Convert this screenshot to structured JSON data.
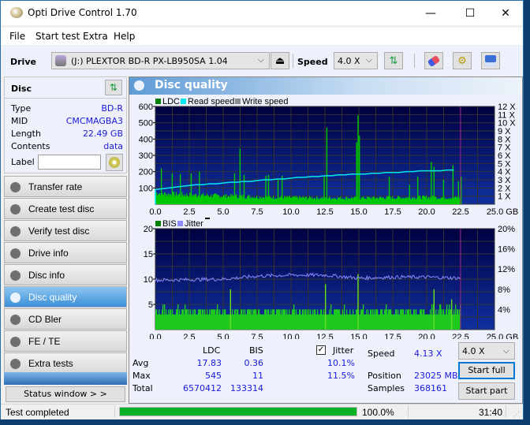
{
  "window": {
    "title": "Opti Drive Control 1.70",
    "controls": {
      "minimize": "—",
      "maximize": "☐",
      "close": "✕"
    }
  },
  "menu": [
    "File",
    "Start test",
    "Extra",
    "Help"
  ],
  "toolbar": {
    "drive_label": "Drive",
    "drive_value": "(J:)   PLEXTOR BD-R  PX-LB950SA 1.04",
    "speed_label": "Speed",
    "speed_value": "4.0 X",
    "icons": [
      "eject-icon",
      "refresh-icon",
      "erase-icon",
      "settings-icon",
      "save-icon"
    ]
  },
  "disc": {
    "header": "Disc",
    "rows": [
      {
        "key": "Type",
        "value": "BD-R"
      },
      {
        "key": "MID",
        "value": "CMCMAGBA3"
      },
      {
        "key": "Length",
        "value": "22.49 GB"
      },
      {
        "key": "Contents",
        "value": "data"
      }
    ],
    "label_key": "Label",
    "label_value": ""
  },
  "nav": [
    {
      "label": "Transfer rate",
      "active": false
    },
    {
      "label": "Create test disc",
      "active": false
    },
    {
      "label": "Verify test disc",
      "active": false
    },
    {
      "label": "Drive info",
      "active": false
    },
    {
      "label": "Disc info",
      "active": false
    },
    {
      "label": "Disc quality",
      "active": true
    },
    {
      "label": "CD Bler",
      "active": false
    },
    {
      "label": "FE / TE",
      "active": false
    },
    {
      "label": "Extra tests",
      "active": false
    }
  ],
  "status_window_button": "Status window > >",
  "panel_title": "Disc quality",
  "colors": {
    "ldc": "#00c800",
    "read_speed": "#00e8f0",
    "write_speed": "#8c8c8c",
    "bis": "#1ec81e",
    "jitter": "#8a8aff",
    "plot_bg": "#00005a",
    "progress": "#06b025",
    "value_blue": "#1a1adc"
  },
  "chart_data": [
    {
      "type": "bar",
      "title": "LDC / Read speed",
      "legend": [
        "LDC",
        "Read speed",
        "Write speed"
      ],
      "legend_position": "top-left",
      "xlabel": "GB",
      "x_ticks": [
        "0.0",
        "2.5",
        "5.0",
        "7.5",
        "10.0",
        "12.5",
        "15.0",
        "17.5",
        "20.0",
        "22.5",
        "25.0 GB"
      ],
      "xlim": [
        0,
        25
      ],
      "ylim": [
        0,
        600
      ],
      "y_ticks": [
        "100",
        "200",
        "300",
        "400",
        "500",
        "600"
      ],
      "y2_ticks": [
        "1 X",
        "2 X",
        "3 X",
        "4 X",
        "5 X",
        "6 X",
        "7 X",
        "8 X",
        "9 X",
        "10 X",
        "11 X",
        "12 X"
      ],
      "y2lim": [
        0,
        12
      ],
      "grid": true,
      "end_marker_gb": 22.49,
      "ldc_baseline": [
        [
          0,
          70
        ],
        [
          1,
          60
        ],
        [
          2,
          58
        ],
        [
          3,
          55
        ],
        [
          5,
          50
        ],
        [
          7.5,
          45
        ],
        [
          10,
          40
        ],
        [
          12.5,
          38
        ],
        [
          15,
          38
        ],
        [
          17.5,
          40
        ],
        [
          20,
          42
        ],
        [
          22.49,
          40
        ]
      ],
      "ldc_spikes": [
        [
          0.4,
          220
        ],
        [
          1.2,
          190
        ],
        [
          1.8,
          185
        ],
        [
          2.6,
          190
        ],
        [
          3.2,
          200
        ],
        [
          5.8,
          190
        ],
        [
          6.2,
          340
        ],
        [
          6.5,
          180
        ],
        [
          8.1,
          175
        ],
        [
          8.3,
          180
        ],
        [
          9.0,
          150
        ],
        [
          9.3,
          175
        ],
        [
          12.6,
          470
        ],
        [
          12.4,
          170
        ],
        [
          14.9,
          545
        ],
        [
          14.8,
          380
        ],
        [
          15.0,
          420
        ],
        [
          17.2,
          170
        ],
        [
          18.7,
          120
        ],
        [
          19.3,
          170
        ],
        [
          20.3,
          260
        ],
        [
          20.5,
          230
        ],
        [
          21.2,
          150
        ],
        [
          21.9,
          240
        ],
        [
          22.3,
          140
        ],
        [
          22.5,
          170
        ]
      ],
      "read_speed": [
        [
          0,
          1.8
        ],
        [
          1,
          2.0
        ],
        [
          2.5,
          2.3
        ],
        [
          5,
          2.6
        ],
        [
          7.5,
          2.9
        ],
        [
          10,
          3.2
        ],
        [
          12.5,
          3.5
        ],
        [
          15,
          3.7
        ],
        [
          17.5,
          3.9
        ],
        [
          20,
          4.1
        ],
        [
          22.49,
          4.2
        ]
      ]
    },
    {
      "type": "bar",
      "title": "BIS / Jitter",
      "legend": [
        "BIS",
        "Jitter"
      ],
      "legend_position": "top-left",
      "xlabel": "GB",
      "x_ticks": [
        "0.0",
        "2.5",
        "5.0",
        "7.5",
        "10.0",
        "12.5",
        "15.0",
        "17.5",
        "20.0",
        "22.5",
        "25.0 GB"
      ],
      "xlim": [
        0,
        25
      ],
      "ylim": [
        0,
        20
      ],
      "y_ticks": [
        "5",
        "10",
        "15",
        "20"
      ],
      "y2_ticks": [
        "4%",
        "8%",
        "12%",
        "16%",
        "20%"
      ],
      "y2lim": [
        0,
        20
      ],
      "grid": true,
      "end_marker_gb": 22.49,
      "bis_typical": [
        3,
        4
      ],
      "bis_spikes": [
        [
          5.5,
          8
        ],
        [
          12.5,
          9
        ],
        [
          14.9,
          11
        ],
        [
          20.5,
          8
        ],
        [
          21.8,
          6
        ]
      ],
      "jitter": [
        [
          0,
          9.8
        ],
        [
          2.5,
          9.9
        ],
        [
          5,
          10.0
        ],
        [
          7.5,
          10.6
        ],
        [
          10,
          10.8
        ],
        [
          12.5,
          10.8
        ],
        [
          15,
          10.2
        ],
        [
          17.5,
          10.4
        ],
        [
          20,
          10.4
        ],
        [
          22.49,
          10.2
        ]
      ]
    }
  ],
  "stats": {
    "col_ldc": "LDC",
    "col_bis": "BIS",
    "jitter_label": "Jitter",
    "jitter_checked": true,
    "rows": [
      {
        "label": "Avg",
        "ldc": "17.83",
        "bis": "0.36",
        "jitter": "10.1%"
      },
      {
        "label": "Max",
        "ldc": "545",
        "bis": "11",
        "jitter": "11.5%"
      },
      {
        "label": "Total",
        "ldc": "6570412",
        "bis": "133314",
        "jitter": ""
      }
    ],
    "speed_label": "Speed",
    "speed_value": "4.13 X",
    "position_label": "Position",
    "position_value": "23025 MB",
    "samples_label": "Samples",
    "samples_value": "368161",
    "speed_select": "4.0 X",
    "start_full": "Start full",
    "start_part": "Start part"
  },
  "statusbar": {
    "text": "Test completed",
    "progress_percent": 100,
    "progress_text": "100.0%",
    "elapsed": "31:40"
  }
}
